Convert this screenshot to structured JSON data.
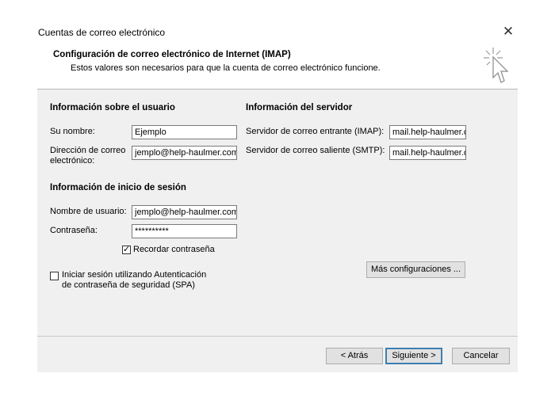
{
  "dialog": {
    "title": "Cuentas de correo electrónico",
    "header_title": "Configuración de correo electrónico de Internet (IMAP)",
    "header_subtitle": "Estos valores son necesarios para que la cuenta de correo electrónico funcione."
  },
  "user_info": {
    "heading": "Información sobre el usuario",
    "name_label": "Su nombre:",
    "name_value": "Ejemplo",
    "email_label_line1": "Dirección de correo",
    "email_label_line2": "electrónico:",
    "email_value": "jemplo@help-haulmer.com"
  },
  "server_info": {
    "heading": "Información del servidor",
    "incoming_label": "Servidor de correo entrante (IMAP):",
    "incoming_value": "mail.help-haulmer.c",
    "outgoing_label": "Servidor de correo saliente (SMTP):",
    "outgoing_value": "mail.help-haulmer.c"
  },
  "login_info": {
    "heading": "Información de inicio de sesión",
    "username_label": "Nombre de usuario:",
    "username_value": "jemplo@help-haulmer.com",
    "password_label": "Contraseña:",
    "password_value": "**********",
    "remember_label": "Recordar contraseña",
    "remember_checked": true,
    "remember_mark": "✓",
    "spa_label_line1": "Iniciar sesión utilizando Autenticación",
    "spa_label_line2": "de contraseña de seguridad (SPA)",
    "spa_checked": false
  },
  "buttons": {
    "more_settings": "Más configuraciones ...",
    "back": "< Atrás",
    "next": "Siguiente >",
    "cancel": "Cancelar",
    "close_glyph": "✕"
  },
  "colors": {
    "panel_bg": "#f0f0f0",
    "default_button_border": "#3c7fb1"
  },
  "icons": {
    "header_icon": "cursor-sparkle-icon"
  }
}
